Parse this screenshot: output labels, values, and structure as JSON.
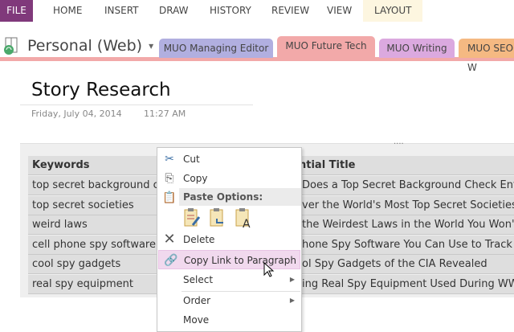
{
  "ribbon": {
    "tabs": [
      "FILE",
      "HOME",
      "INSERT",
      "DRAW",
      "HISTORY",
      "REVIEW",
      "VIEW",
      "LAYOUT"
    ]
  },
  "notebook": {
    "name": "Personal (Web)",
    "dropdown": "▾"
  },
  "sections": [
    "MUO Managing Editor",
    "MUO Future Tech",
    "MUO Writing",
    "MUO SEO W"
  ],
  "page": {
    "title": "Story Research",
    "date": "Friday, July 04, 2014",
    "time": "11:27 AM",
    "handle": "····"
  },
  "table": {
    "headers": [
      "Keywords",
      "ntial Title"
    ],
    "rows": [
      [
        "top secret background che",
        "Does a Top Secret Background Check Entail?"
      ],
      [
        "top secret societies",
        "ver the World's Most Top Secret Societies"
      ],
      [
        "weird laws",
        "the Weirdest Laws in the World You Won't B"
      ],
      [
        "cell phone spy software",
        "hone Spy Software You Can Use to Track Sm"
      ],
      [
        "cool spy gadgets",
        "ol Spy Gadgets of the CIA Revealed"
      ],
      [
        "real spy equipment",
        "ing Real Spy Equipment Used During WWII"
      ]
    ]
  },
  "menu": {
    "cut": "Cut",
    "copy": "Copy",
    "paste_options": "Paste Options:",
    "delete": "Delete",
    "copy_link": "Copy Link to Paragraph",
    "select": "Select",
    "order": "Order",
    "move": "Move"
  },
  "colors": {
    "file": "#80397b",
    "active_tab": "#f2a9a9",
    "highlight": "#f1d9ee"
  }
}
